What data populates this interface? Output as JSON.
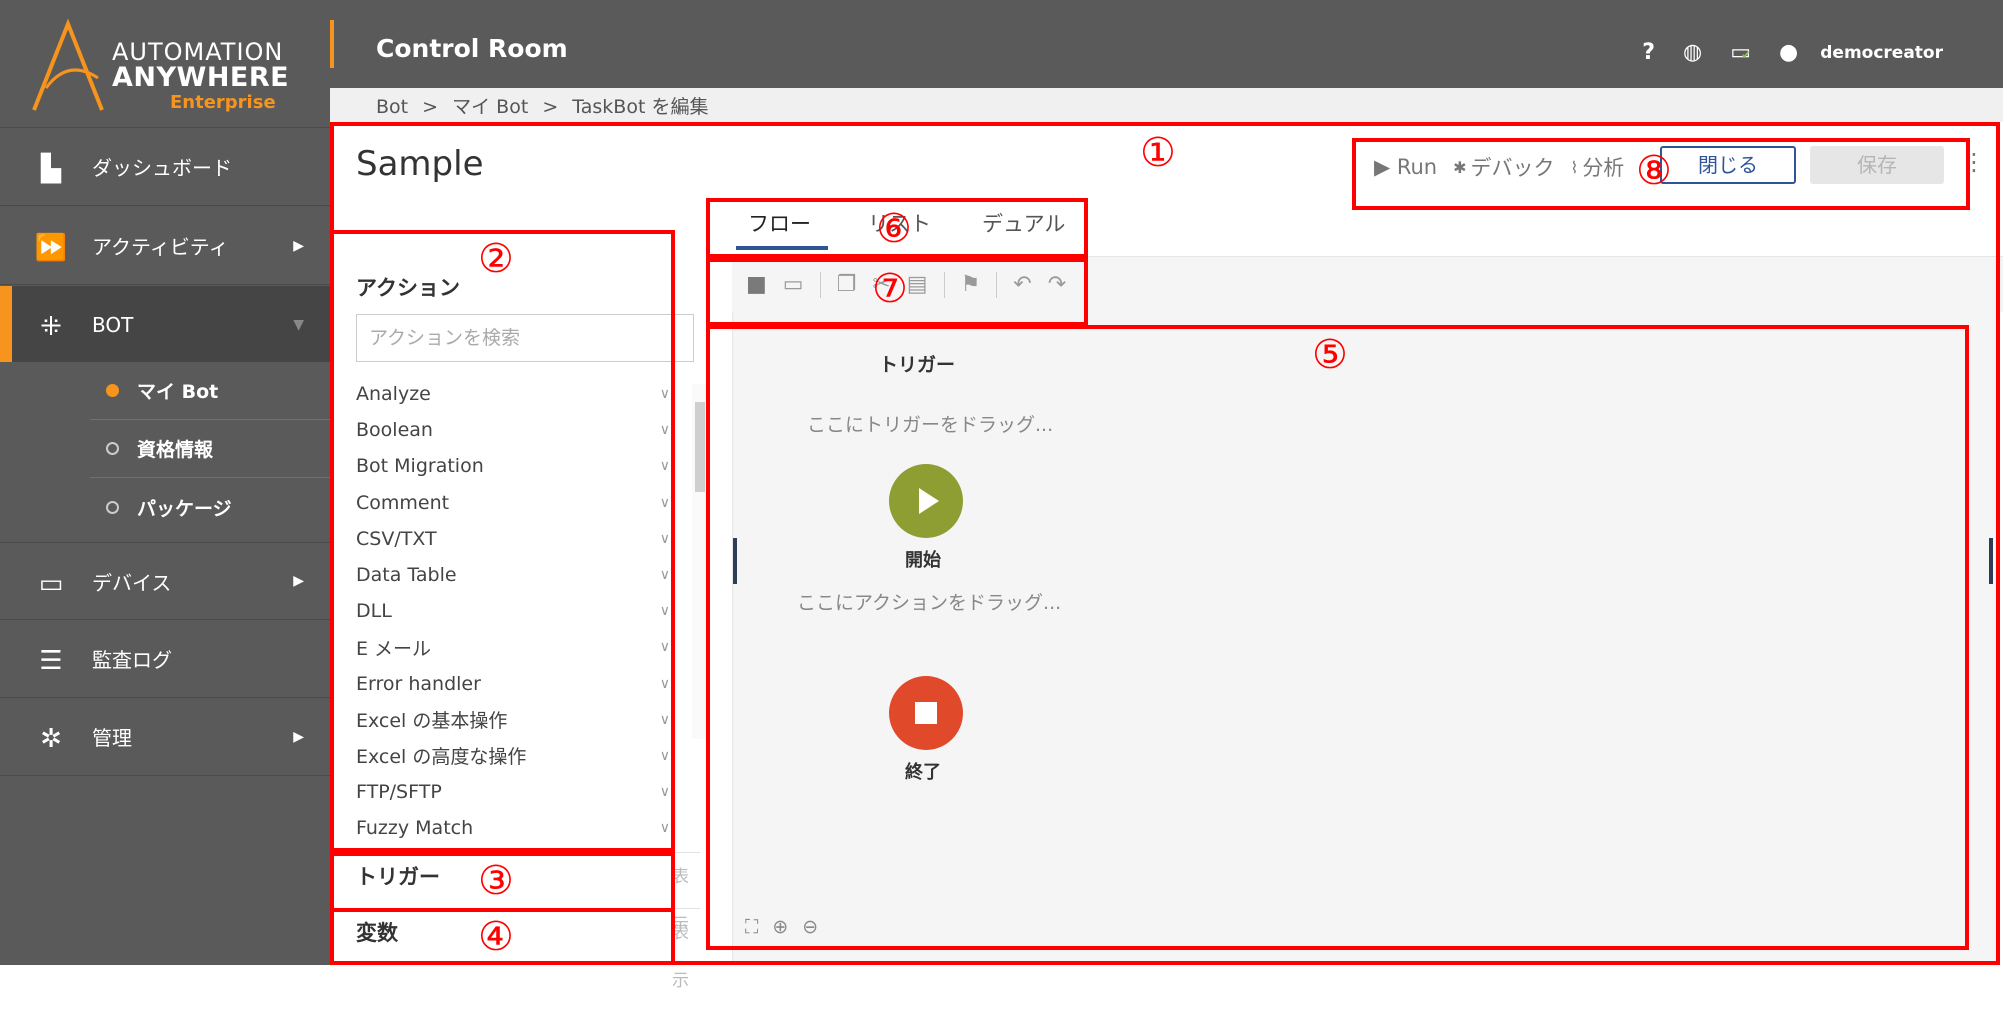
{
  "logo": {
    "line1": "AUTOMATION",
    "line2": "ANYWHERE",
    "line3": "Enterprise"
  },
  "sidebar": {
    "items": [
      {
        "label": "ダッシュボード",
        "icon": "dashboard-icon"
      },
      {
        "label": "アクティビティ",
        "icon": "activity-icon"
      },
      {
        "label": "BOT",
        "icon": "bot-icon"
      },
      {
        "label": "デバイス",
        "icon": "device-icon"
      },
      {
        "label": "監査ログ",
        "icon": "list-icon"
      },
      {
        "label": "管理",
        "icon": "admin-gear-icon"
      }
    ],
    "sub_items": [
      {
        "label": "マイ Bot"
      },
      {
        "label": "資格情報"
      },
      {
        "label": "パッケージ"
      }
    ]
  },
  "header": {
    "title": "Control Room",
    "help": "?",
    "user": "democreator"
  },
  "breadcrumb": {
    "bot": "Bot",
    "sep": ">",
    "mybot": "マイ Bot",
    "edit": "TaskBot を編集"
  },
  "editor": {
    "title": "Sample",
    "run": "▶ Run",
    "debug": "デバック",
    "analyze": "分析",
    "close": "閉じる",
    "save": "保存",
    "tabs": [
      "フロー",
      "リスト",
      "デュアル"
    ]
  },
  "actions": {
    "heading": "アクション",
    "search_placeholder": "アクションを検索",
    "items": [
      "Analyze",
      "Boolean",
      "Bot Migration",
      "Comment",
      "CSV/TXT",
      "Data Table",
      "DLL",
      "E メール",
      "Error handler",
      "Excel の基本操作",
      "Excel の高度な操作",
      "FTP/SFTP",
      "Fuzzy Match"
    ],
    "triggers": "トリガー",
    "variables": "変数",
    "show": "表示"
  },
  "canvas": {
    "trigger_label": "トリガー",
    "drag_trigger": "ここにトリガーをドラッグ...",
    "start": "開始",
    "drag_action": "ここにアクションをドラッグ...",
    "end": "終了"
  },
  "annotations": [
    "①",
    "②",
    "③",
    "④",
    "⑤",
    "⑥",
    "⑦",
    "⑧"
  ],
  "colors": {
    "accent": "#f7941d",
    "annotation": "#ff0000",
    "start": "#8f9e33",
    "end": "#e04a2a",
    "brand_blue": "#2f5597"
  }
}
